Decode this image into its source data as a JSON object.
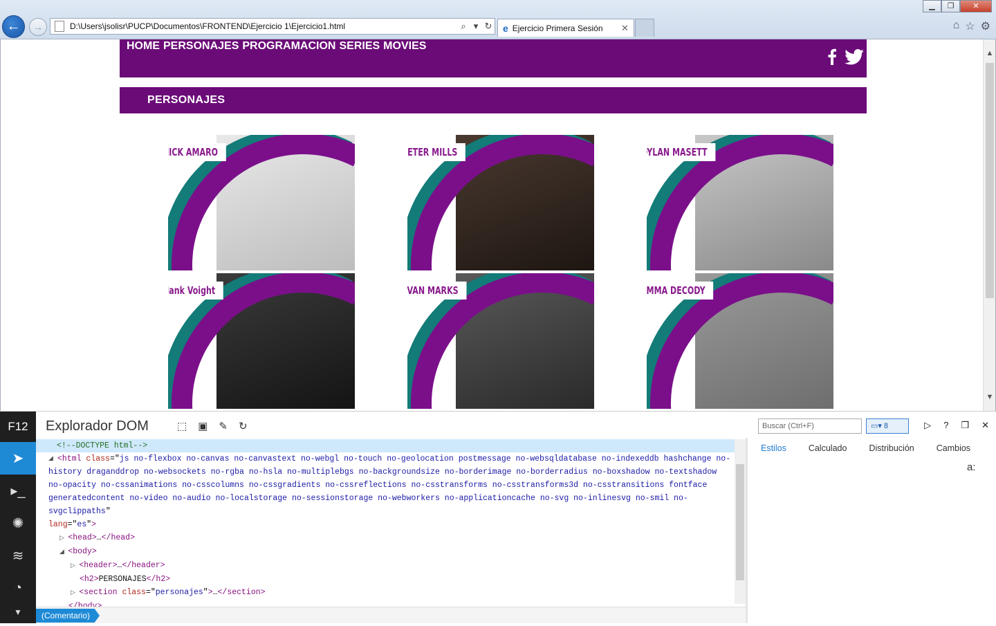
{
  "browser": {
    "address": "D:\\Users\\jsolisr\\PUCP\\Documentos\\FRONTEND\\Ejercicio 1\\Ejercicio1.html",
    "tab_title": "Ejercicio Primera Sesión"
  },
  "site": {
    "nav": [
      "HOME",
      "PERSONAJES",
      "PROGRAMACION",
      "SERIES",
      "MOVIES"
    ],
    "section_title": "PERSONAJES",
    "characters": [
      "NICK AMARO",
      "PETER MILLS",
      "DYLAN MASETT",
      "Hank Voight",
      "EVAN MARKS",
      "EMMA DECODY"
    ]
  },
  "devtools": {
    "f12": "F12",
    "title": "Explorador DOM",
    "search_placeholder": "Buscar (Ctrl+F)",
    "emulation_count": "8",
    "right_tabs": [
      "Estilos",
      "Calculado",
      "Distribución",
      "Cambios"
    ],
    "aa": "a:",
    "breadcrumb": "(Comentario)",
    "dom": {
      "l1": "<!--DOCTYPE html-->",
      "html_class": "js no-flexbox no-canvas no-canvastext no-webgl no-touch no-geolocation postmessage no-websqldatabase no-indexeddb hashchange no-history draganddrop no-websockets no-rgba no-hsla no-multiplebgs no-backgroundsize no-borderimage no-borderradius no-boxshadow no-textshadow no-opacity no-cssanimations no-csscolumns no-cssgradients no-cssreflections no-csstransforms no-csstransforms3d no-csstransitions fontface generatedcontent no-video no-audio no-localstorage no-sessionstorage no-webworkers no-applicationcache no-svg no-inlinesvg no-smil no-svgclippaths",
      "lang": "es",
      "h2_text": "PERSONAJES",
      "section_class": "personajes"
    }
  }
}
